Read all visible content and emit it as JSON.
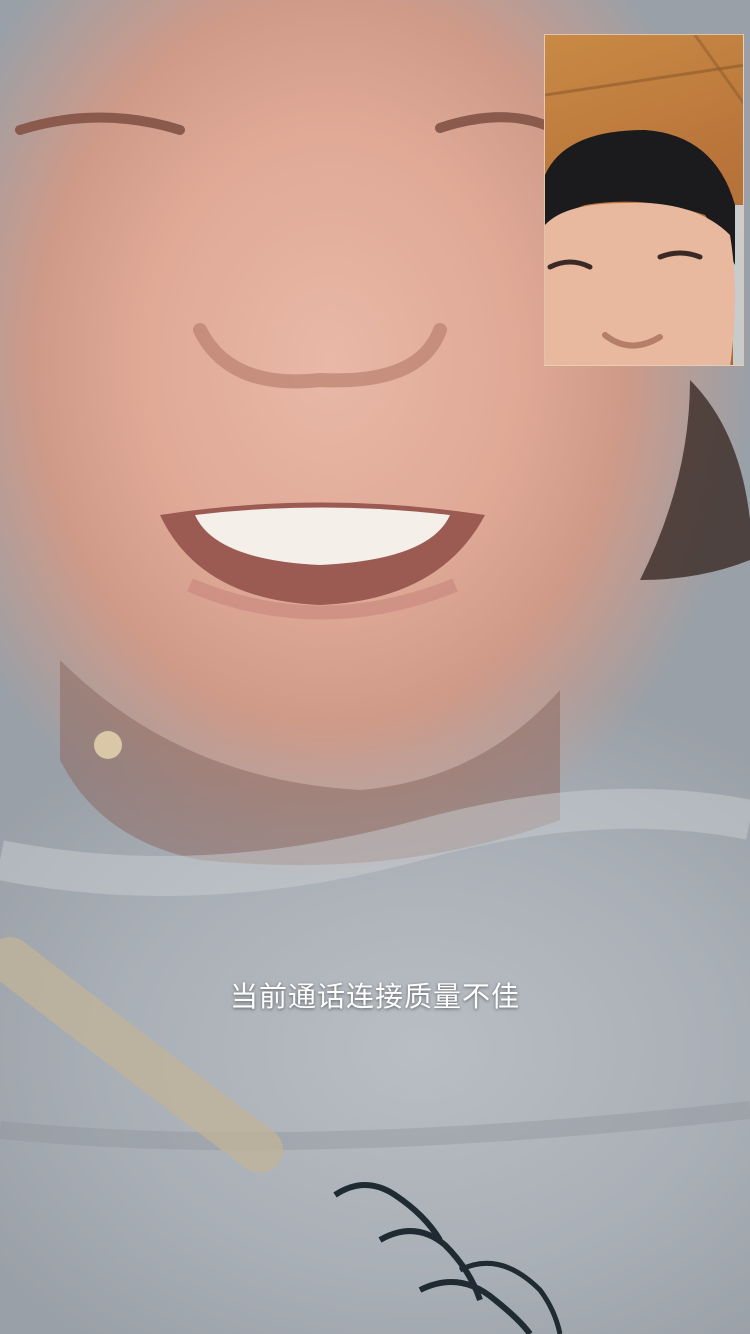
{
  "call": {
    "status_message": "当前通话连接质量不佳"
  },
  "colors": {
    "status_text": "#ffffff",
    "preview_border": "#ffffff"
  }
}
